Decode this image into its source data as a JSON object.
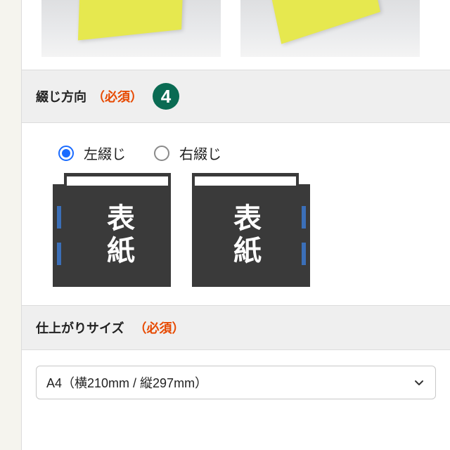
{
  "binding": {
    "header_label": "綴じ方向",
    "required_label": "（必須）",
    "step_number": "4",
    "options": {
      "left": {
        "label": "左綴じ",
        "selected": true
      },
      "right": {
        "label": "右綴じ",
        "selected": false
      }
    },
    "cover_text": "表紙"
  },
  "size": {
    "header_label": "仕上がりサイズ",
    "required_label": "（必須）",
    "selected_value": "A4（横210mm / 縦297mm）"
  }
}
